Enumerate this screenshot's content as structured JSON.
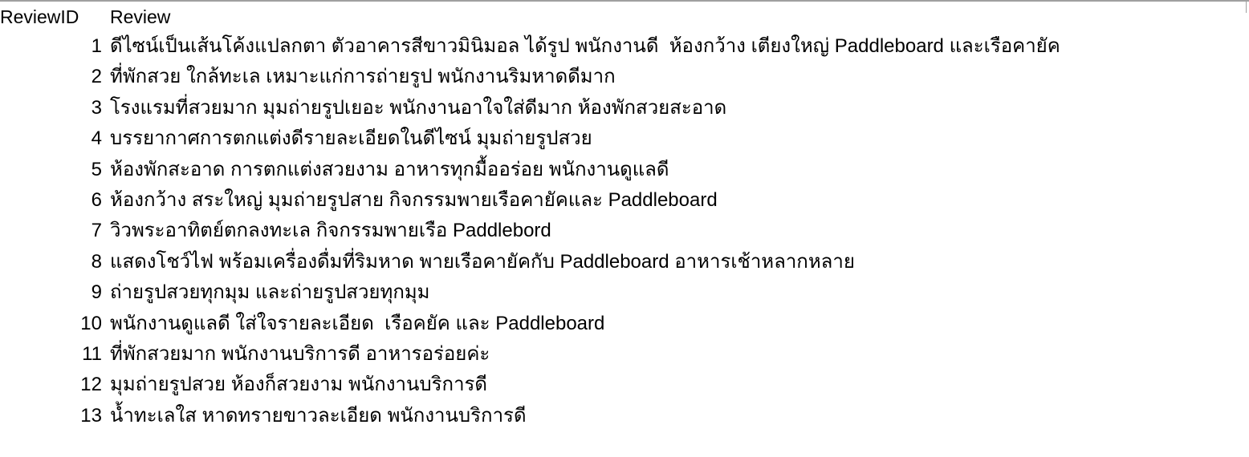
{
  "columns": {
    "id": "ReviewID",
    "review": "Review"
  },
  "rows": [
    {
      "id": "1",
      "review": "ดีไซน์เป็นเส้นโค้งแปลกตา ตัวอาคารสีขาวมินิมอล ได้รูป พนักงานดี  ห้องกว้าง เตียงใหญ่ Paddleboard และเรือคายัค"
    },
    {
      "id": "2",
      "review": "ที่พักสวย ใกล้ทะเล เหมาะแก่การถ่ายรูป พนักงานริมหาดดีมาก"
    },
    {
      "id": "3",
      "review": "โรงแรมที่สวยมาก มุมถ่ายรูปเยอะ พนักงานอาใจใส่ดีมาก ห้องพักสวยสะอาด"
    },
    {
      "id": "4",
      "review": "บรรยากาศการตกแต่งดีรายละเอียดในดีไซน์ มุมถ่ายรูปสวย"
    },
    {
      "id": "5",
      "review": "ห้องพักสะอาด การตกแต่งสวยงาม อาหารทุกมื้ออร่อย พนักงานดูแลดี"
    },
    {
      "id": "6",
      "review": "ห้องกว้าง สระใหญ่ มุมถ่ายรูปสาย กิจกรรมพายเรือคายัคและ Paddleboard"
    },
    {
      "id": "7",
      "review": "วิวพระอาทิตย์ตกลงทะเล กิจกรรมพายเรือ Paddlebord"
    },
    {
      "id": "8",
      "review": "แสดงโชว์ไฟ พร้อมเครื่องดื่มที่ริมหาด พายเรือคายัคกับ Paddleboard อาหารเช้าหลากหลาย"
    },
    {
      "id": "9",
      "review": "ถ่ายรูปสวยทุกมุม และถ่ายรูปสวยทุกมุม"
    },
    {
      "id": "10",
      "review": "พนักงานดูแลดี ใส่ใจรายละเอียด  เรือคยัค และ Paddleboard"
    },
    {
      "id": "11",
      "review": "ที่พักสวยมาก พนักงานบริการดี อาหารอร่อยค่ะ"
    },
    {
      "id": "12",
      "review": "มุมถ่ายรูปสวย ห้องก็สวยงาม พนักงานบริการดี"
    },
    {
      "id": "13",
      "review": "น้ำทะเลใส หาดทรายขาวละเอียด พนักงานบริการดี"
    }
  ]
}
